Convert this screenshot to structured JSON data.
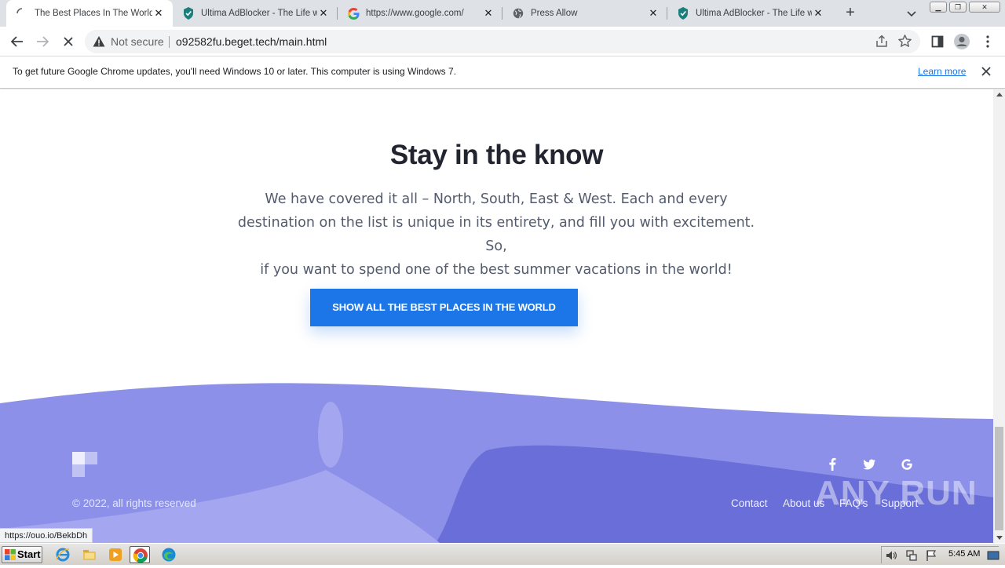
{
  "tabs": [
    {
      "title": "The Best Places In The World",
      "favicon": "loading-spinner-icon",
      "active": true
    },
    {
      "title": "Ultima AdBlocker - The Life wit",
      "favicon": "shield-icon",
      "active": false
    },
    {
      "title": "https://www.google.com/",
      "favicon": "google-icon",
      "active": false
    },
    {
      "title": "Press Allow",
      "favicon": "globe-icon",
      "active": false
    },
    {
      "title": "Ultima AdBlocker - The Life wit",
      "favicon": "shield-icon",
      "active": false
    }
  ],
  "toolbar": {
    "security_label": "Not secure",
    "url": "o92582fu.beget.tech/main.html"
  },
  "infobar": {
    "message": "To get future Google Chrome updates, you'll need Windows 10 or later. This computer is using Windows 7.",
    "link": "Learn more"
  },
  "page": {
    "heading": "Stay in the know",
    "paragraph_lines": [
      "We have covered it all – North, South, East & West. Each and every",
      "destination on the list is unique in its entirety, and fill you with excitement. So,",
      "if you want to spend one of the best summer vacations in the world!"
    ],
    "cta_label": "SHOW ALL THE BEST PLACES IN THE WORLD",
    "footer": {
      "copyright": "© 2022, all rights reserved",
      "links": [
        "Contact",
        "About us",
        "FAQ's",
        "Support"
      ],
      "social": [
        "facebook-icon",
        "twitter-icon",
        "google-icon"
      ]
    },
    "watermark": "ANY RUN"
  },
  "status_url": "https://ouo.io/BekbDh",
  "taskbar": {
    "start_label": "Start",
    "clock": "5:45 AM"
  },
  "colors": {
    "accent_blue": "#1d76e8",
    "footer_light": "#8c90e8",
    "footer_dark": "#6a6ed8",
    "footer_pale": "#a4a6ef"
  }
}
